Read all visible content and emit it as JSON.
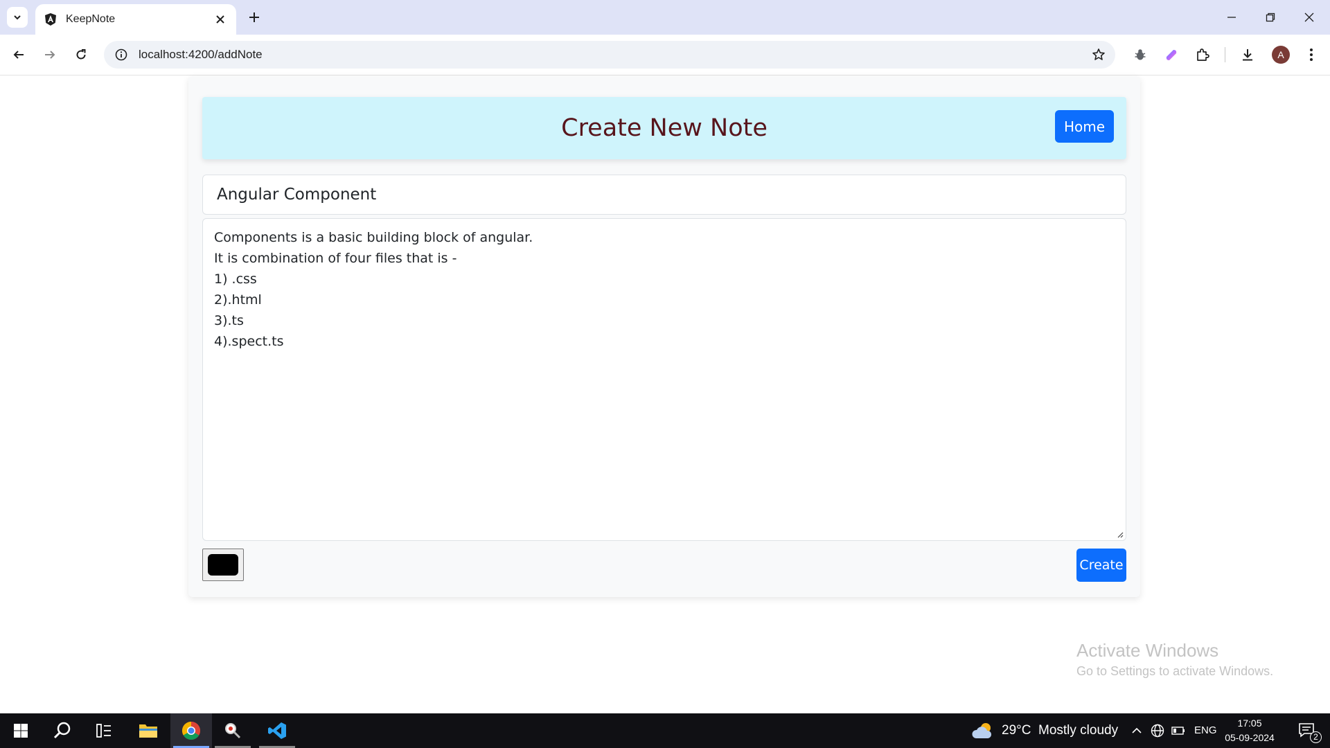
{
  "browser": {
    "tab_title": "KeepNote",
    "url": "localhost:4200/addNote",
    "profile_initial": "A"
  },
  "page": {
    "heading": "Create New Note",
    "home_label": "Home",
    "title_value": "Angular Component",
    "content_lines": [
      "Components is a basic building block of angular.",
      "It is combination of four files that is -",
      "1) .css",
      "2).html",
      "3).ts",
      "4).spect.ts"
    ],
    "color_value": "#000000",
    "create_label": "Create"
  },
  "watermark": {
    "title": "Activate Windows",
    "subtitle": "Go to Settings to activate Windows."
  },
  "taskbar": {
    "weather": "29°C  Mostly cloudy",
    "language": "ENG",
    "time": "17:05",
    "date": "05-09-2024",
    "notification_count": "2"
  },
  "colors": {
    "header_bg": "#cff4fc",
    "heading_text": "#58151c",
    "primary_button": "#0d6efd",
    "tabstrip_bg": "#dfe3f7",
    "taskbar_bg": "#101014"
  }
}
